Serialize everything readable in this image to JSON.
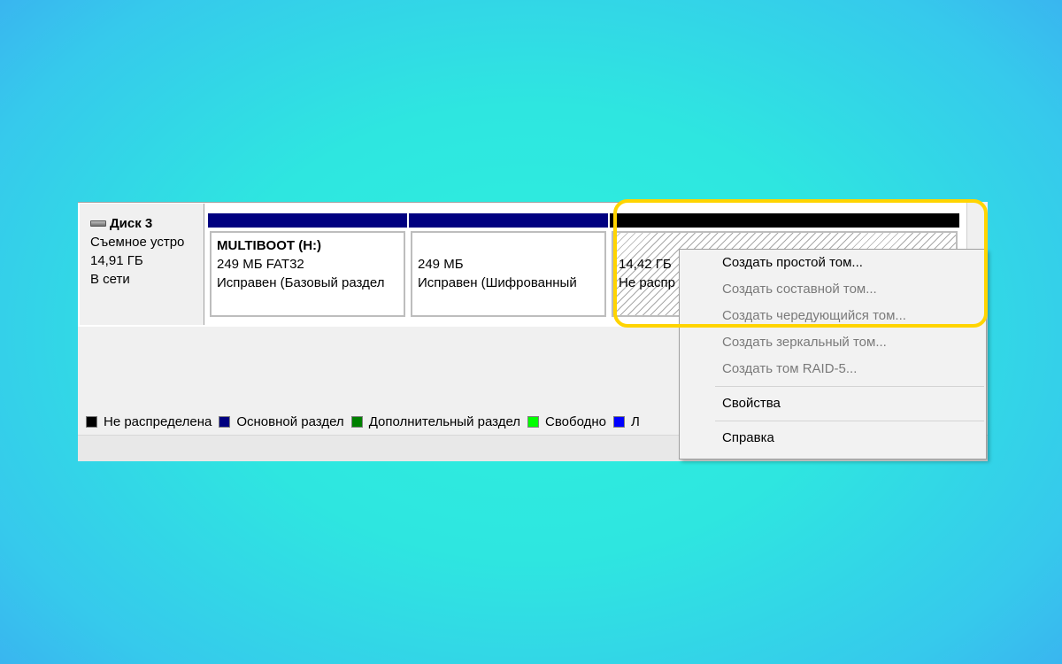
{
  "disk": {
    "name": "Диск 3",
    "type": "Съемное устро",
    "size": "14,91 ГБ",
    "status": "В сети"
  },
  "partitions": [
    {
      "name": "MULTIBOOT  (H:)",
      "details": "249 МБ FAT32",
      "status": "Исправен (Базовый раздел"
    },
    {
      "name": "",
      "details": "249 МБ",
      "status": "Исправен (Шифрованный"
    },
    {
      "name": "",
      "details": "14,42 ГБ",
      "status": "Не распр"
    }
  ],
  "legend": [
    {
      "label": "Не распределена",
      "color": "#000000"
    },
    {
      "label": "Основной раздел",
      "color": "#000080"
    },
    {
      "label": "Дополнительный раздел",
      "color": "#008000"
    },
    {
      "label": "Свободно",
      "color": "#00ff00"
    },
    {
      "label": "Л",
      "color": "#0000ff"
    }
  ],
  "context_menu": {
    "items": [
      {
        "label": "Создать простой том...",
        "enabled": true
      },
      {
        "label": "Создать составной том...",
        "enabled": false
      },
      {
        "label": "Создать чередующийся том...",
        "enabled": false
      },
      {
        "label": "Создать зеркальный том...",
        "enabled": false
      },
      {
        "label": "Создать том RAID-5...",
        "enabled": false
      },
      {
        "label": "Свойства",
        "enabled": true
      },
      {
        "label": "Справка",
        "enabled": true
      }
    ]
  },
  "colors": {
    "primary_partition": "#000080",
    "unallocated": "#000000",
    "highlight": "#ffd400"
  }
}
